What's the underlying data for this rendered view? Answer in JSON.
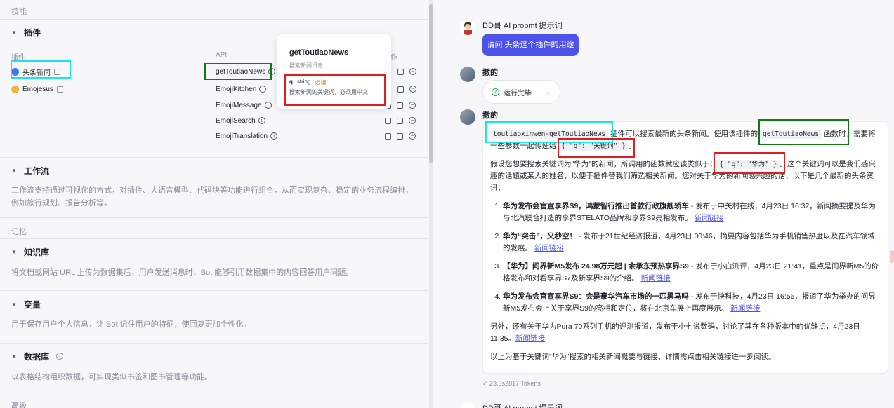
{
  "left": {
    "skills_label": "技能",
    "plugins": {
      "title": "插件",
      "col_plugin": "插件",
      "col_api": "API",
      "col_action": "作",
      "plugin_items": [
        "头条新闻",
        "Emojesus"
      ],
      "api_items": [
        "getToutiaoNews",
        "EmojiKitchen",
        "EmojiMessage",
        "EmojiSearch",
        "EmojiTranslation"
      ]
    },
    "tooltip": {
      "title": "getToutiaoNews",
      "subtitle": "搜索新闻讯息",
      "param_name": "q",
      "param_type": "string",
      "param_required": "必填",
      "param_desc": "搜索新闻的关键词，必须用中文"
    },
    "workflow": {
      "title": "工作流",
      "desc": "工作流支持通过可视化的方式，对插件、大语言模型、代码块等功能进行组合，从而实现复杂、稳定的业务流程编排，例如旅行规划、报告分析等。"
    },
    "memory_label": "记忆",
    "knowledge": {
      "title": "知识库",
      "desc": "将文档或网站 URL 上传为数据集后，用户发送消息时，Bot 能够引用数据集中的内容回答用户问题。"
    },
    "variables": {
      "title": "变量",
      "desc": "用于保存用户个人信息，让 Bot 记住用户的特征，使回复更加个性化。"
    },
    "database": {
      "title": "数据库",
      "desc": "以表格结构组织数据，可实现类似书签和图书管理等功能。"
    },
    "advanced_label": "高级"
  },
  "chat": {
    "user_name": "DD哥 AI propmt 提示词",
    "user_message": "请问 头条这个插件的用途",
    "bot_name": "撒的",
    "run_status": "运行完毕",
    "answer": {
      "p1_code1": "toutiaoxinwen-getToutiaoNews",
      "p1_text1": " 插件可以搜索最新的头条新闻。使用该插件的 ",
      "p1_code2": "getToutiaoNews",
      "p1_text2": " 函数时，需要将一些参数一起传递给 ",
      "p1_code3": "{ \"q\": \"关键词\" }",
      "p1_text3": "。",
      "p2_text1": "假设您想要搜索关键词为\"华为\"的新闻，所调用的函数就应该类似于：",
      "p2_code": "{ \"q\": \"华为\" }",
      "p2_text2": "。这个关键词可以是我们感兴趣的话题或某人的姓名，以便于插件替我们筛选相关新闻。您对关于华为的新闻感兴趣的话，以下是几个最新的头条资讯：",
      "items": [
        {
          "bold": "华为发布会官宣享界S9，鸿蒙智行推出首款行政旗舰轿车",
          "rest": " - 发布于中关村在线，4月23日 16:32，新闻摘要提及华为与北汽联合打造的享界STELATO品牌和享界S9亮相发布。",
          "link": "新闻链接"
        },
        {
          "bold": "华为“突击”，又秒空！",
          "rest": " - 发布于21世纪经济报道，4月23日 00:46，摘要内容包括华为手机销售热度以及在汽车领域的发展。",
          "link": "新闻链接"
        },
        {
          "bold": "【华为】问界新M5发布 24.98万元起 | 余承东预热享界S9",
          "rest": " - 发布于小白测评，4月23日 21:41，重点是问界新M5的价格发布和对看享界S7及新享界S9的介绍。",
          "link": "新闻链接"
        },
        {
          "bold": "华为发布会官宣享界S9：会是豪华汽车市场的一匹黑马吗",
          "rest": " - 发布于快科技，4月23日 16:56，报道了华为举办的问界新M5发布会上关于享界S9的亮相和定位，将在北京车展上再度展示。",
          "link": "新闻链接"
        }
      ],
      "p3_text": "另外，还有关于华为Pura 70系列手机的评测报道，发布于小七说数码，讨论了其在各种版本中的优缺点，4月23日 11:35。",
      "p3_link": "新闻链接",
      "p4_text": "以上为基于关键词\"华为\"搜索的相关新闻概要与链接，详情需点击相关链接进一步阅读。"
    },
    "tokens": "✓ 23.3s2817 Tokens",
    "next_name": "DD哥 AI propmt 提示词"
  }
}
